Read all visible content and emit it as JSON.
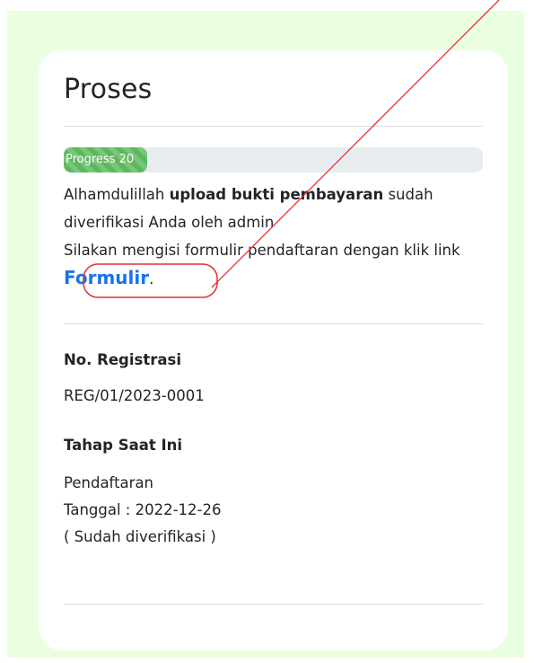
{
  "card": {
    "title": "Proses"
  },
  "progress": {
    "label": "Progress 20",
    "value_percent": 20
  },
  "message": {
    "part1": "Alhamdulillah ",
    "bold": "upload bukti pembayaran",
    "part2": " sudah diverifikasi Anda oleh admin",
    "line2": "Silakan mengisi formulir pendaftaran dengan klik link ",
    "link_label": "Formulir",
    "trailing": "."
  },
  "registration": {
    "label": "No. Registrasi",
    "value": "REG/01/2023-0001"
  },
  "stage": {
    "label": "Tahap Saat Ini",
    "name": "Pendaftaran",
    "date": "Tanggal : 2022-12-26",
    "status": "( Sudah diverifikasi )"
  },
  "colors": {
    "page_background": "#eaffdf",
    "card_background": "#ffffff",
    "progress_fill": "#5cb85c",
    "link": "#1a73e8",
    "annotation": "#e03030"
  }
}
